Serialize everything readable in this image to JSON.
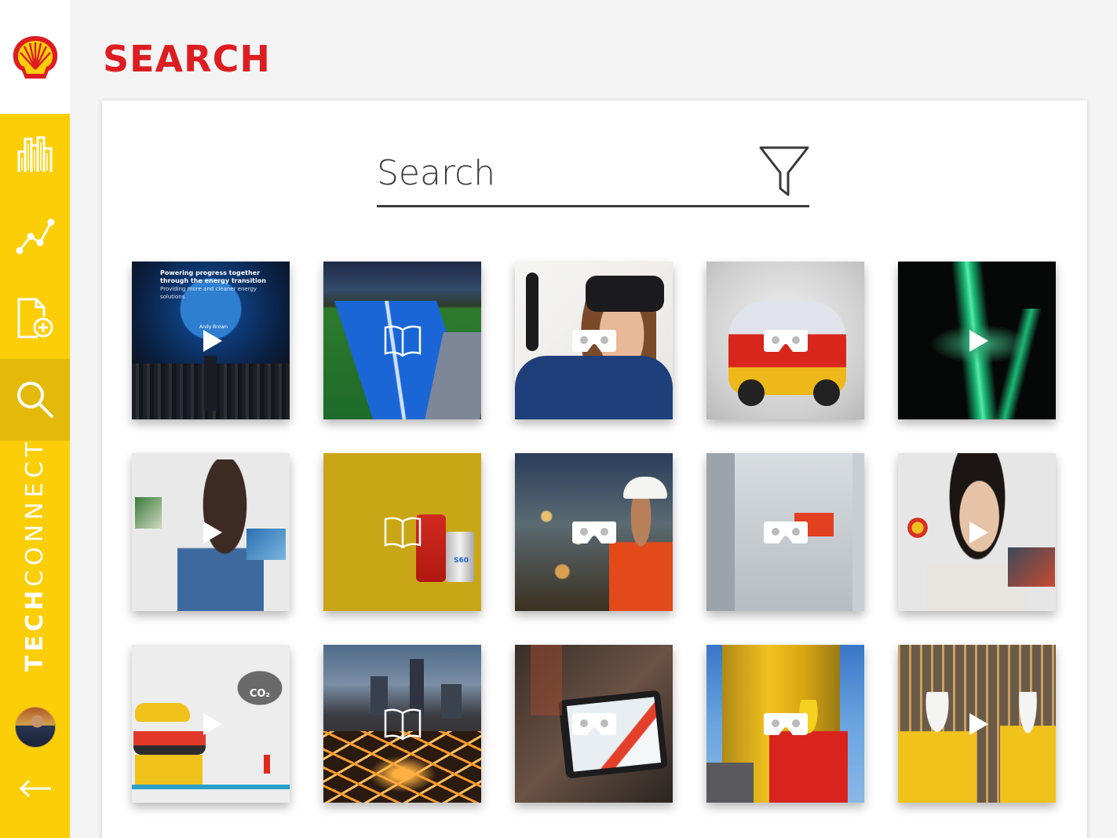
{
  "app": {
    "brand_bold": "TECH",
    "brand_light": "CONNECT",
    "accent_color": "#fbce07",
    "brand_red": "#dd1d21"
  },
  "sidebar": {
    "items": [
      {
        "name": "dashboard",
        "icon": "city-bars-icon",
        "active": false
      },
      {
        "name": "analytics",
        "icon": "line-chart-icon",
        "active": false
      },
      {
        "name": "add-document",
        "icon": "add-document-icon",
        "active": false
      },
      {
        "name": "search",
        "icon": "search-icon",
        "active": true
      }
    ],
    "back_icon": "arrow-left-icon"
  },
  "header": {
    "title": "SEARCH"
  },
  "search": {
    "placeholder": "Search",
    "value": "",
    "filter_icon": "filter-icon"
  },
  "tiles": [
    {
      "type": "video",
      "overlay_icon": "play-icon",
      "title": "Powering progress together through the energy transition",
      "subtitle": "Providing more and cleaner energy solutions",
      "caption": "Andy Brown"
    },
    {
      "type": "document",
      "overlay_icon": "book-icon"
    },
    {
      "type": "vr",
      "overlay_icon": "vr-headset-icon"
    },
    {
      "type": "vr",
      "overlay_icon": "vr-headset-icon"
    },
    {
      "type": "video",
      "overlay_icon": "play-icon"
    },
    {
      "type": "video",
      "overlay_icon": "play-icon"
    },
    {
      "type": "document",
      "overlay_icon": "book-icon",
      "label": "S60"
    },
    {
      "type": "vr",
      "overlay_icon": "vr-headset-icon"
    },
    {
      "type": "vr",
      "overlay_icon": "vr-headset-icon"
    },
    {
      "type": "video",
      "overlay_icon": "play-icon"
    },
    {
      "type": "video",
      "overlay_icon": "play-icon",
      "label": "CO₂"
    },
    {
      "type": "document",
      "overlay_icon": "book-icon"
    },
    {
      "type": "vr",
      "overlay_icon": "vr-headset-icon"
    },
    {
      "type": "vr",
      "overlay_icon": "vr-headset-icon"
    },
    {
      "type": "video",
      "overlay_icon": "play-icon"
    }
  ]
}
